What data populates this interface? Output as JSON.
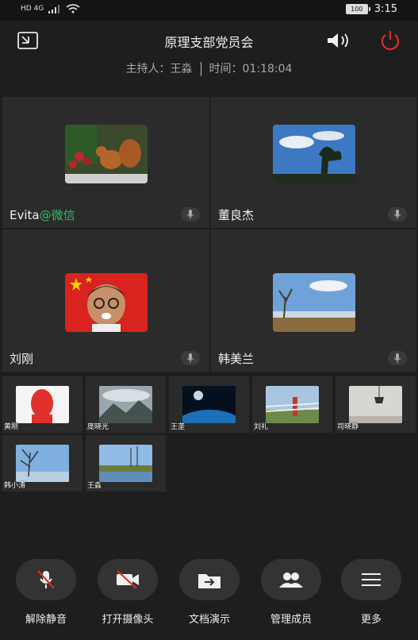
{
  "status_bar": {
    "network": "HD 4G",
    "battery": "100",
    "time": "3:15"
  },
  "header": {
    "title": "原理支部党员会",
    "host_label": "主持人：",
    "host_name": "王淼",
    "time_label": "时间：",
    "duration": "01:18:04"
  },
  "participants_main": [
    {
      "name": "Evita",
      "suffix": "@微信",
      "video": "squirrel-photo"
    },
    {
      "name": "董良杰",
      "suffix": "",
      "video": "sky-tree-photo"
    },
    {
      "name": "刘刚",
      "suffix": "",
      "video": "cartoon-avatar"
    },
    {
      "name": "韩美兰",
      "suffix": "",
      "video": "lake-shore-photo"
    }
  ],
  "participants_small": [
    {
      "name": "黄刚",
      "thumb": "red-portrait"
    },
    {
      "name": "庞晓光",
      "thumb": "mountain-clouds"
    },
    {
      "name": "王垄",
      "thumb": "planet-space"
    },
    {
      "name": "刘礼",
      "thumb": "fence-road"
    },
    {
      "name": "司晓静",
      "thumb": "lamp-wall"
    },
    {
      "name": "韩小涛",
      "thumb": "winter-tree"
    },
    {
      "name": "王淼",
      "thumb": "lake-reflection"
    }
  ],
  "controls": [
    {
      "label": "解除静音",
      "icon": "mic-off-icon"
    },
    {
      "label": "打开摄像头",
      "icon": "camera-off-icon"
    },
    {
      "label": "文档演示",
      "icon": "folder-share-icon"
    },
    {
      "label": "管理成员",
      "icon": "members-icon"
    },
    {
      "label": "更多",
      "icon": "menu-icon"
    }
  ],
  "colors": {
    "background": "#1e1e1e",
    "tile": "#2b2b2b",
    "wechat_green": "#2fbd68",
    "power_red": "#e02a2a"
  }
}
